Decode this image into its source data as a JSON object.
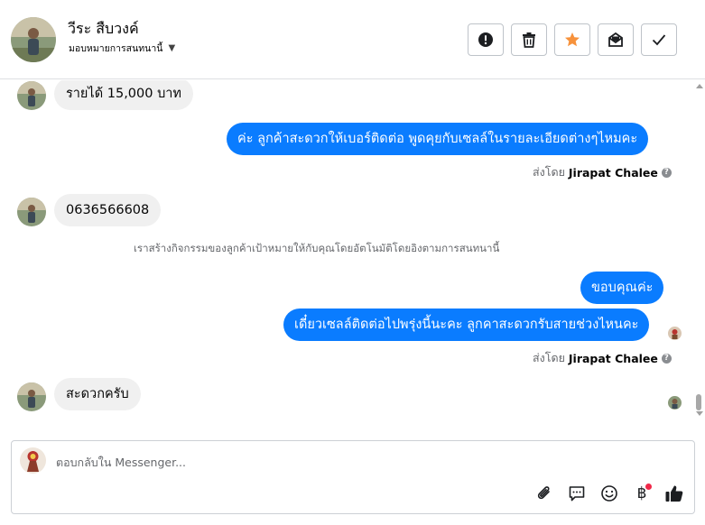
{
  "header": {
    "contact_name": "วีระ สืบวงค์",
    "assign_label": "มอบหมายการสนทนานี้"
  },
  "actions": [
    {
      "name": "report-icon"
    },
    {
      "name": "trash-icon"
    },
    {
      "name": "star-icon",
      "color": "#f7923b"
    },
    {
      "name": "mark-unread-icon"
    },
    {
      "name": "check-icon"
    }
  ],
  "thread": {
    "messages": [
      {
        "from": "customer",
        "text": "รายได้ 15,000 บาท"
      },
      {
        "from": "page",
        "text": "ค่ะ ลูกค้าสะดวกให้เบอร์ติดต่อ พูดคุยกับเซลล์ในรายละเอียดต่างๆไหมคะ"
      },
      {
        "from": "customer",
        "text": "0636566608"
      },
      {
        "from": "page",
        "text": "ขอบคุณค่ะ"
      },
      {
        "from": "page",
        "text": "เดี๋ยวเซลล์ติดต่อไปพรุ่งนี้นะคะ  ลูกคาสะดวกรับสายช่วงไหนคะ"
      },
      {
        "from": "customer",
        "text": "สะดวกครับ"
      }
    ],
    "sent_by_prefix": "ส่งโดย",
    "sent_by_name": "Jirapat Chalee",
    "help_glyph": "?",
    "system_note": "เราสร้างกิจกรรมของลูกค้าเป้าหมายให้กับคุณโดยอัตโนมัติโดยอิงตามการสนทนานี้"
  },
  "composer": {
    "placeholder": "ตอบกลับใน Messenger...",
    "tools": [
      "attach-icon",
      "saved-replies-icon",
      "emoji-icon",
      "payment-icon",
      "like-icon"
    ],
    "payment_glyph": "฿"
  },
  "colors": {
    "outgoing_bubble": "#0a7cff",
    "incoming_bubble": "#f0f0f0",
    "notification_dot": "#f02849"
  }
}
